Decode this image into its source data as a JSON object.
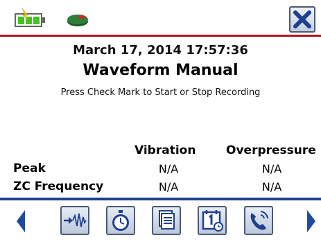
{
  "header": {
    "icons": [
      "battery-charging-icon",
      "memory-disk-icon"
    ],
    "close_icon": "close-icon"
  },
  "main": {
    "datetime": "March 17, 2014 17:57:36",
    "mode_title": "Waveform Manual",
    "instruction": "Press Check Mark to Start or Stop Recording"
  },
  "table": {
    "columns": [
      "Vibration",
      "Overpressure"
    ],
    "rows": [
      {
        "label": "Peak",
        "values": [
          "N/A",
          "N/A"
        ]
      },
      {
        "label": "ZC Frequency",
        "values": [
          "N/A",
          "N/A"
        ]
      }
    ]
  },
  "toolbar": {
    "buttons": [
      "waveform-icon",
      "timer-icon",
      "documents-icon",
      "calendar-clock-icon",
      "phone-call-icon"
    ],
    "nav": [
      "left-arrow-icon",
      "right-arrow-icon"
    ]
  },
  "colors": {
    "header_line": "#b3121f",
    "toolbar_line": "#1f3f8f",
    "icon_blue": "#1f3f8f"
  }
}
